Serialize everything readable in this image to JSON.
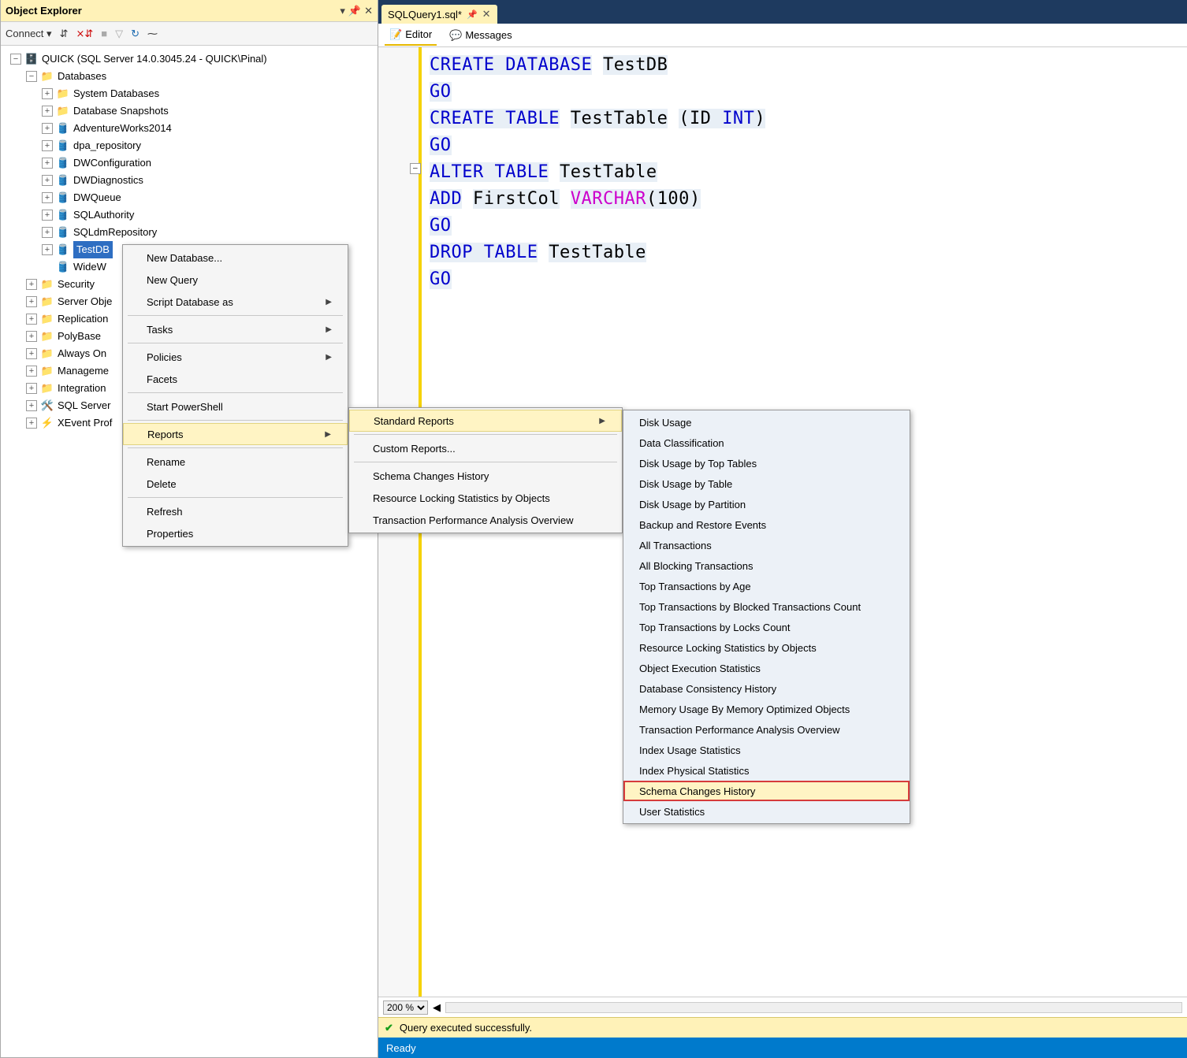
{
  "oe": {
    "title": "Object Explorer",
    "connect": "Connect ▾",
    "root": "QUICK (SQL Server 14.0.3045.24 - QUICK\\Pinal)",
    "databases": "Databases",
    "sysdb": "System Databases",
    "snap": "Database Snapshots",
    "dbs": [
      "AdventureWorks2014",
      "dpa_repository",
      "DWConfiguration",
      "DWDiagnostics",
      "DWQueue",
      "SQLAuthority",
      "SQLdmRepository",
      "TestDB",
      "WideW"
    ],
    "others": [
      "Security",
      "Server Obje",
      "Replication",
      "PolyBase",
      "Always On",
      "Manageme",
      "Integration",
      "SQL Server",
      "XEvent Prof"
    ]
  },
  "tab": {
    "title": "SQLQuery1.sql*",
    "editor": "Editor",
    "messages": "Messages"
  },
  "zoom": "200 %",
  "status_query": "Query executed successfully.",
  "status_ready": "Ready",
  "sql": {
    "l1a": "CREATE",
    "l1b": "DATABASE",
    "l1c": "TestDB",
    "go": "GO",
    "l3a": "CREATE",
    "l3b": "TABLE",
    "l3c": "TestTable",
    "l3d": "(",
    "l3e": "ID",
    "l3f": "INT",
    "l3g": ")",
    "l5a": "ALTER",
    "l5b": "TABLE",
    "l5c": "TestTable",
    "l6a": "ADD",
    "l6b": "FirstCol",
    "l6c": "VARCHAR",
    "l6d": "(",
    "l6e": "100",
    "l6f": ")",
    "l8a": "DROP",
    "l8b": "TABLE",
    "l8c": "TestTable"
  },
  "ctx1": {
    "newdb": "New Database...",
    "newq": "New Query",
    "script": "Script Database as",
    "tasks": "Tasks",
    "policies": "Policies",
    "facets": "Facets",
    "ps": "Start PowerShell",
    "reports": "Reports",
    "rename": "Rename",
    "delete": "Delete",
    "refresh": "Refresh",
    "props": "Properties"
  },
  "ctx2": {
    "std": "Standard Reports",
    "custom": "Custom Reports...",
    "sch": "Schema Changes History",
    "rl": "Resource Locking Statistics by Objects",
    "tp": "Transaction Performance Analysis Overview"
  },
  "ctx3": {
    "i1": "Disk Usage",
    "i2": "Data Classification",
    "i3": "Disk Usage by Top Tables",
    "i4": "Disk Usage by Table",
    "i5": "Disk Usage by Partition",
    "i6": "Backup and Restore Events",
    "i7": "All Transactions",
    "i8": "All Blocking Transactions",
    "i9": "Top Transactions by Age",
    "i10": "Top Transactions by Blocked Transactions Count",
    "i11": "Top Transactions by Locks Count",
    "i12": "Resource Locking Statistics by Objects",
    "i13": "Object Execution Statistics",
    "i14": "Database Consistency History",
    "i15": "Memory Usage By Memory Optimized Objects",
    "i16": "Transaction Performance Analysis Overview",
    "i17": "Index Usage Statistics",
    "i18": "Index Physical Statistics",
    "i19": "Schema Changes History",
    "i20": "User Statistics"
  }
}
